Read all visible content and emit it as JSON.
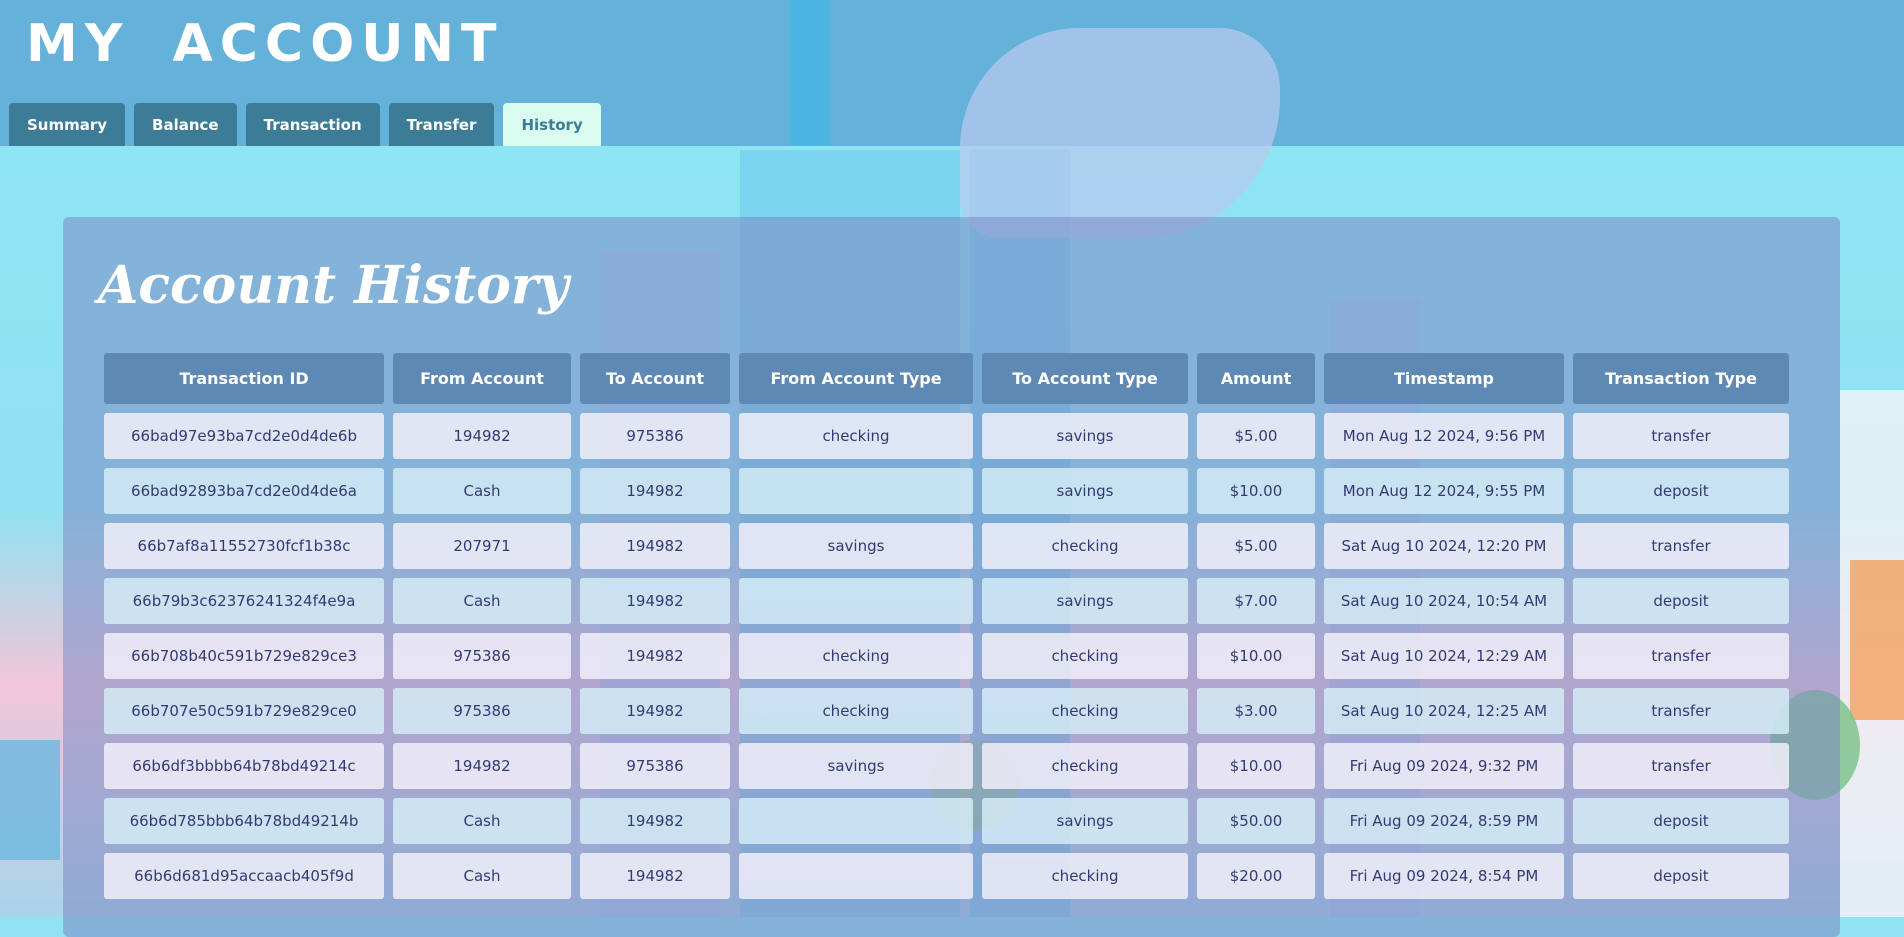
{
  "app": {
    "title": "MY  ACCOUNT"
  },
  "tabs": [
    "Summary",
    "Balance",
    "Transaction",
    "Transfer",
    "History"
  ],
  "active_tab": "History",
  "history": {
    "title": "Account History",
    "columns": [
      "Transaction ID",
      "From Account",
      "To Account",
      "From Account Type",
      "To Account Type",
      "Amount",
      "Timestamp",
      "Transaction Type"
    ],
    "rows": [
      [
        "66bad97e93ba7cd2e0d4de6b",
        "194982",
        "975386",
        "checking",
        "savings",
        "$5.00",
        "Mon Aug 12 2024, 9:56 PM",
        "transfer"
      ],
      [
        "66bad92893ba7cd2e0d4de6a",
        "Cash",
        "194982",
        "",
        "savings",
        "$10.00",
        "Mon Aug 12 2024, 9:55 PM",
        "deposit"
      ],
      [
        "66b7af8a11552730fcf1b38c",
        "207971",
        "194982",
        "savings",
        "checking",
        "$5.00",
        "Sat Aug 10 2024, 12:20 PM",
        "transfer"
      ],
      [
        "66b79b3c62376241324f4e9a",
        "Cash",
        "194982",
        "",
        "savings",
        "$7.00",
        "Sat Aug 10 2024, 10:54 AM",
        "deposit"
      ],
      [
        "66b708b40c591b729e829ce3",
        "975386",
        "194982",
        "checking",
        "checking",
        "$10.00",
        "Sat Aug 10 2024, 12:29 AM",
        "transfer"
      ],
      [
        "66b707e50c591b729e829ce0",
        "975386",
        "194982",
        "checking",
        "checking",
        "$3.00",
        "Sat Aug 10 2024, 12:25 AM",
        "transfer"
      ],
      [
        "66b6df3bbbb64b78bd49214c",
        "194982",
        "975386",
        "savings",
        "checking",
        "$10.00",
        "Fri Aug 09 2024, 9:32 PM",
        "transfer"
      ],
      [
        "66b6d785bbb64b78bd49214b",
        "Cash",
        "194982",
        "",
        "savings",
        "$50.00",
        "Fri Aug 09 2024, 8:59 PM",
        "deposit"
      ],
      [
        "66b6d681d95accaacb405f9d",
        "Cash",
        "194982",
        "",
        "checking",
        "$20.00",
        "Fri Aug 09 2024, 8:54 PM",
        "deposit"
      ]
    ]
  }
}
